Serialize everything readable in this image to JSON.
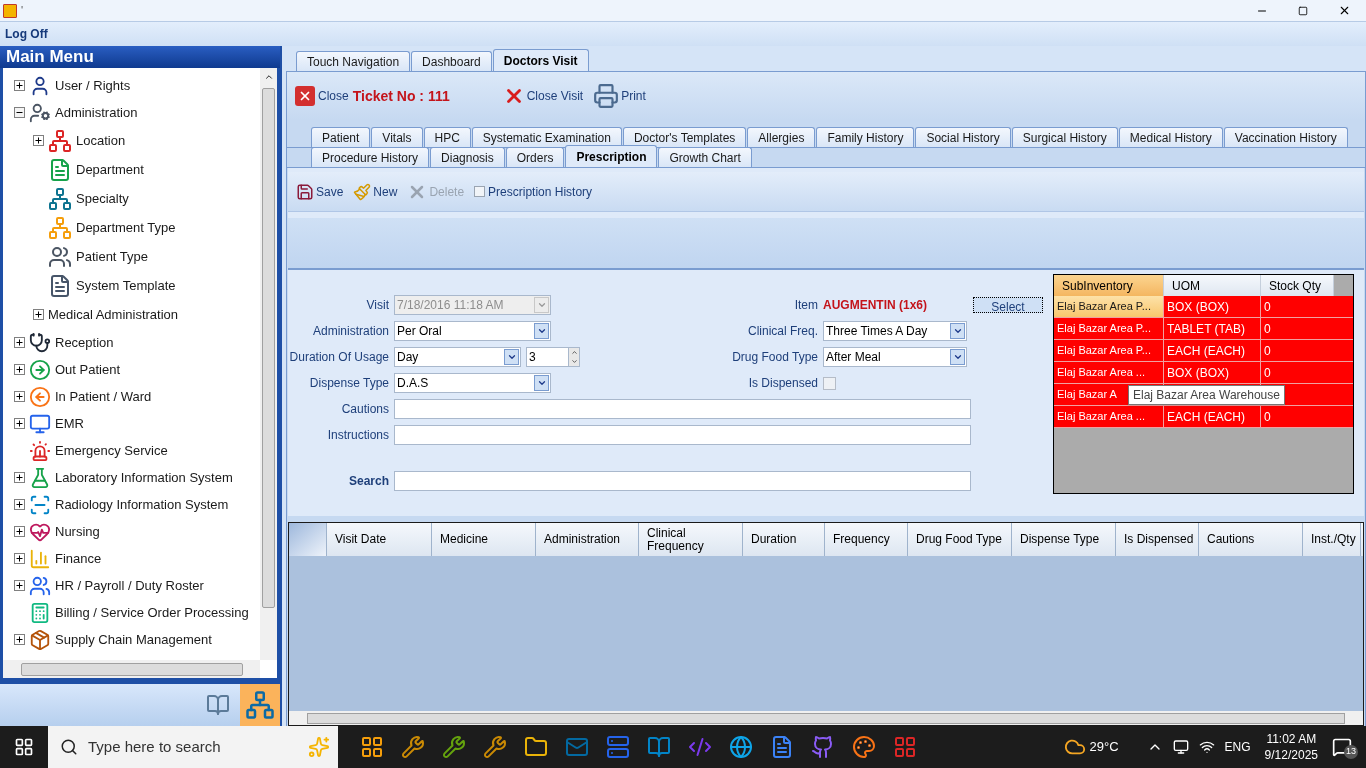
{
  "window": {
    "title": "'"
  },
  "menu_bar": {
    "items": [
      "Log Off"
    ]
  },
  "main_menu": {
    "title": "Main Menu",
    "items": [
      {
        "label": "User / Rights",
        "kind": "branch",
        "expanded": false
      },
      {
        "label": "Administration",
        "kind": "branch",
        "expanded": true,
        "children": [
          {
            "label": "Location",
            "kind": "branch",
            "expanded": false
          },
          {
            "label": "Department",
            "kind": "leaf"
          },
          {
            "label": "Specialty",
            "kind": "leaf"
          },
          {
            "label": "Department Type",
            "kind": "leaf"
          },
          {
            "label": "Patient Type",
            "kind": "leaf"
          },
          {
            "label": "System Template",
            "kind": "leaf"
          },
          {
            "label": "Medical Administration",
            "kind": "branch",
            "expanded": false
          }
        ]
      },
      {
        "label": "Reception",
        "kind": "branch",
        "expanded": false
      },
      {
        "label": "Out Patient",
        "kind": "branch",
        "expanded": false
      },
      {
        "label": "In Patient / Ward",
        "kind": "branch",
        "expanded": false
      },
      {
        "label": "EMR",
        "kind": "branch",
        "expanded": false
      },
      {
        "label": "Emergency Service",
        "kind": "leaf"
      },
      {
        "label": "Laboratory Information System",
        "kind": "branch",
        "expanded": false
      },
      {
        "label": "Radiology Information System",
        "kind": "branch",
        "expanded": false
      },
      {
        "label": "Nursing",
        "kind": "branch",
        "expanded": false
      },
      {
        "label": "Finance",
        "kind": "branch",
        "expanded": false
      },
      {
        "label": "HR / Payroll / Duty Roster",
        "kind": "branch",
        "expanded": false
      },
      {
        "label": "Billing / Service Order Processing",
        "kind": "leaf"
      },
      {
        "label": "Supply Chain Management",
        "kind": "branch",
        "expanded": false
      }
    ]
  },
  "main_tabs": [
    {
      "label": "Touch Navigation",
      "selected": false
    },
    {
      "label": "Dashboard",
      "selected": false
    },
    {
      "label": "Doctors Visit",
      "selected": true
    }
  ],
  "visit_toolbar": {
    "close": "Close",
    "ticket": "Ticket No : 111",
    "close_visit": "Close Visit",
    "print": "Print"
  },
  "detail_tabs": [
    [
      {
        "label": "Patient",
        "selected": false
      },
      {
        "label": "Vitals",
        "selected": false
      },
      {
        "label": "HPC",
        "selected": false
      },
      {
        "label": "Systematic Examination",
        "selected": false
      },
      {
        "label": "Doctor's Templates",
        "selected": false
      },
      {
        "label": "Allergies",
        "selected": false
      },
      {
        "label": "Family History",
        "selected": false
      },
      {
        "label": "Social History",
        "selected": false
      },
      {
        "label": "Surgical History",
        "selected": false
      },
      {
        "label": "Medical History",
        "selected": false
      },
      {
        "label": "Vaccination History",
        "selected": false
      }
    ],
    [
      {
        "label": "Procedure History",
        "selected": false
      },
      {
        "label": "Diagnosis",
        "selected": false
      },
      {
        "label": "Orders",
        "selected": false
      },
      {
        "label": "Prescription",
        "selected": true
      },
      {
        "label": "Growth Chart",
        "selected": false
      }
    ]
  ],
  "prescription_toolbar": {
    "save": "Save",
    "new": "New",
    "delete": {
      "label": "Delete",
      "disabled": true
    },
    "history": {
      "label": "Prescription History",
      "checked": false
    }
  },
  "form": {
    "visit": {
      "label": "Visit",
      "value": "7/18/2016 11:18 AM",
      "disabled": true
    },
    "administration": {
      "label": "Administration",
      "value": "Per Oral"
    },
    "duration": {
      "label": "Duration Of Usage",
      "value": "Day",
      "count": "3"
    },
    "dispense_type": {
      "label": "Dispense Type",
      "value": "D.A.S"
    },
    "item": {
      "label": "Item",
      "value": "AUGMENTIN (1x6)"
    },
    "select_button": "Select",
    "clinical_freq": {
      "label": "Clinical Freq.",
      "value": "Three Times A Day"
    },
    "drug_food_type": {
      "label": "Drug Food Type",
      "value": "After Meal"
    },
    "is_dispensed": {
      "label": "Is Dispensed",
      "checked": false
    },
    "cautions": {
      "label": "Cautions"
    },
    "instructions": {
      "label": "Instructions"
    },
    "search": {
      "label": "Search"
    }
  },
  "stock_table": {
    "columns": [
      "SubInventory",
      "UOM",
      "Stock Qty"
    ],
    "rows": [
      {
        "subinventory": "Elaj Bazar Area P...",
        "uom": "BOX (BOX)",
        "qty": "0",
        "selected": true
      },
      {
        "subinventory": "Elaj Bazar Area P...",
        "uom": "TABLET (TAB)",
        "qty": "0",
        "selected": false
      },
      {
        "subinventory": "Elaj Bazar Area P...",
        "uom": "EACH (EACH)",
        "qty": "0",
        "selected": false
      },
      {
        "subinventory": "Elaj Bazar Area ...",
        "uom": "BOX (BOX)",
        "qty": "0",
        "selected": false
      },
      {
        "subinventory": "Elaj Bazar A",
        "selected": false
      },
      {
        "subinventory": "Elaj Bazar Area ...",
        "uom": "EACH (EACH)",
        "qty": "0",
        "selected": false
      }
    ],
    "tooltip": "Elaj Bazar Area Warehouse"
  },
  "prescription_table": {
    "columns": [
      "Visit Date",
      "Medicine",
      "Administration",
      "Clinical Frequency",
      "Duration",
      "Frequency",
      "Drug Food Type",
      "Dispense Type",
      "Is Dispensed",
      "Cautions",
      "Inst./Qty"
    ]
  },
  "taskbar": {
    "search_placeholder": "Type here to search",
    "weather": "29°C",
    "language": "ENG",
    "time": "11:02 AM",
    "date": "9/12/2025",
    "notifications": "13"
  }
}
